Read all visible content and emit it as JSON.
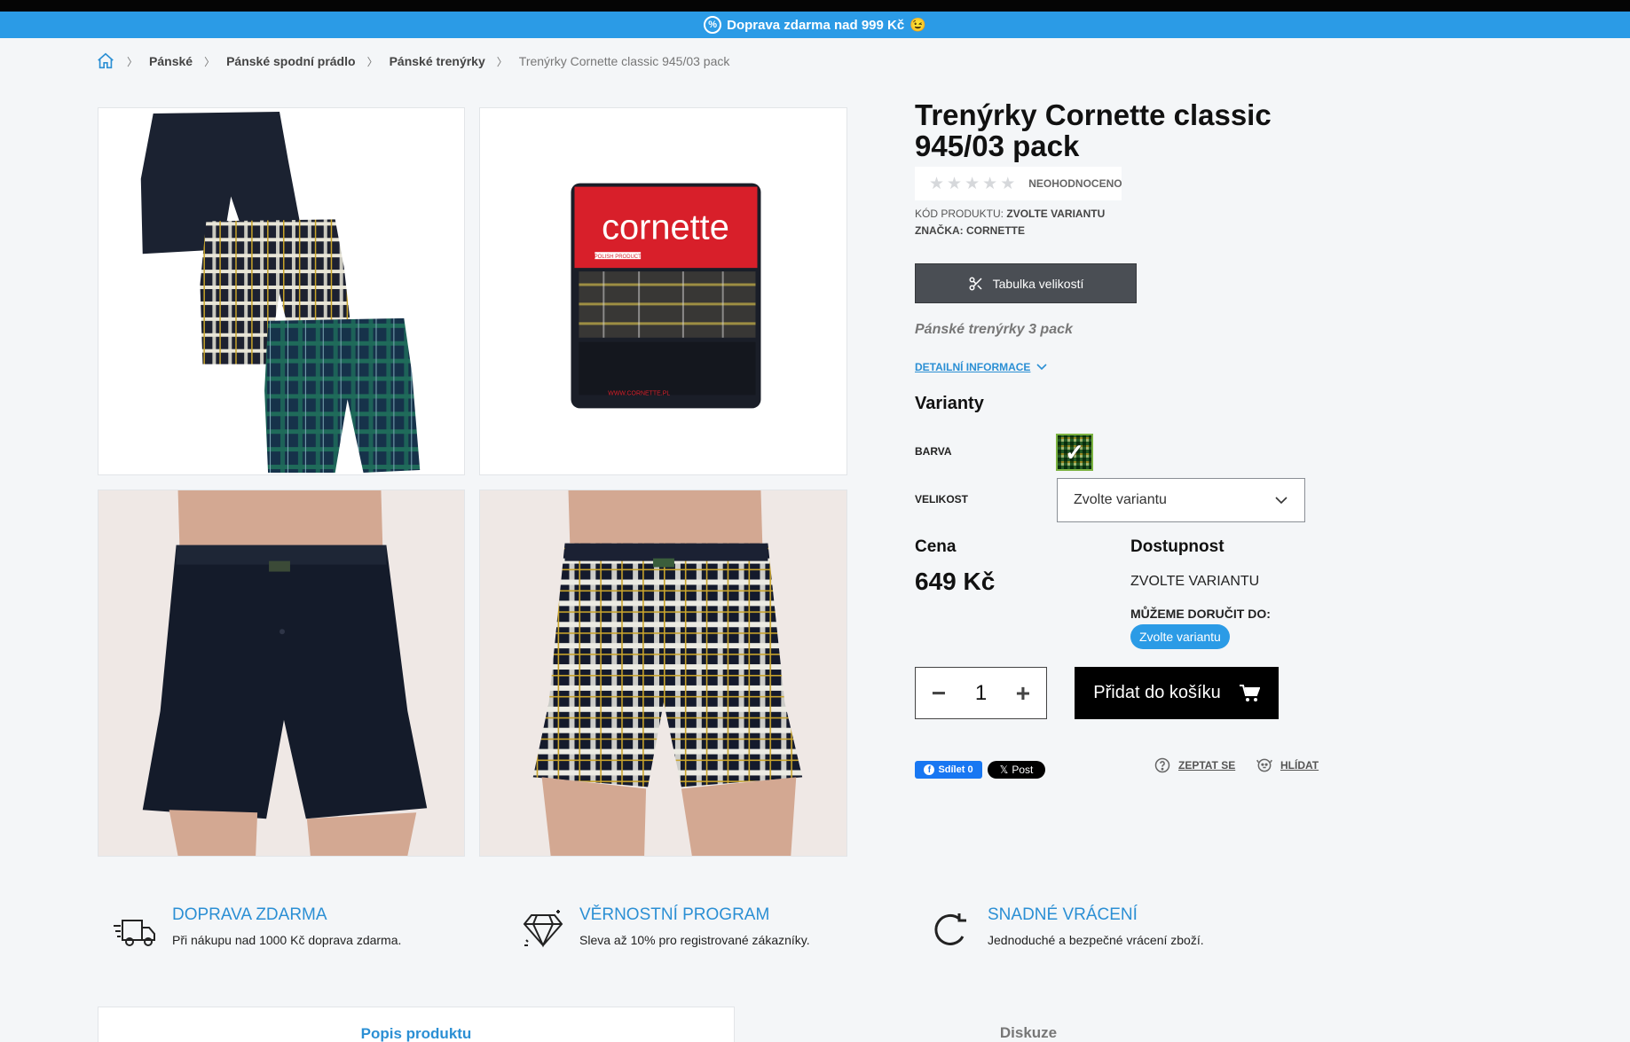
{
  "promo": {
    "text": "Doprava zdarma nad 999 Kč",
    "emoji": "😉",
    "icon": "percent-icon"
  },
  "breadcrumb": [
    {
      "label": "Pánské"
    },
    {
      "label": "Pánské spodní prádlo"
    },
    {
      "label": "Pánské trenýrky"
    }
  ],
  "breadcrumb_current": "Trenýrky Cornette classic 945/03 pack",
  "gallery": {
    "brand_on_pack": "cornette",
    "pack_tag": "POLISH PRODUCT",
    "pack_site": "WWW.CORNETTE.PL"
  },
  "product": {
    "title": "Trenýrky Cornette classic 945/03 pack",
    "rating_label": "NEOHODNOCENO",
    "rating_value": 0,
    "rating_max": 5,
    "code_label": "KÓD PRODUKTU:",
    "code_value": "ZVOLTE VARIANTU",
    "brand_label": "ZNAČKA:",
    "brand_value": "CORNETTE",
    "size_table_label": "Tabulka velikostí",
    "short_desc": "Pánské trenýrky 3 pack",
    "detail_link": "DETAILNÍ INFORMACE",
    "variants_heading": "Varianty",
    "color_label": "BARVA",
    "size_label": "VELIKOST",
    "size_select": "Zvolte variantu",
    "price_heading": "Cena",
    "price": "649 Kč",
    "availability_heading": "Dostupnost",
    "availability_value": "ZVOLTE VARIANTU",
    "deliver_label": "MŮŽEME DORUČIT DO:",
    "deliver_pill": "Zvolte variantu",
    "quantity": "1",
    "add_to_cart": "Přidat do košíku"
  },
  "social": {
    "fb_label": "Sdílet 0",
    "x_label": "Post"
  },
  "actions": {
    "ask": "ZEPTAT SE",
    "watch": "HLÍDAT"
  },
  "benefits": [
    {
      "title": "DOPRAVA ZDARMA",
      "text": "Při nákupu nad 1000 Kč doprava zdarma.",
      "icon": "truck-icon"
    },
    {
      "title": "VĚRNOSTNÍ PROGRAM",
      "text": "Sleva až 10% pro registrované zákazníky.",
      "icon": "diamond-icon"
    },
    {
      "title": "SNADNÉ VRÁCENÍ",
      "text": "Jednoduché a bezpečné vrácení zboží.",
      "icon": "return-arrow-icon"
    }
  ],
  "tabs": [
    {
      "label": "Popis produktu"
    },
    {
      "label": "Diskuze"
    }
  ],
  "colors": {
    "accent": "#2b9be6",
    "dark_button": "#4a4e54",
    "cart_button": "#000000"
  }
}
